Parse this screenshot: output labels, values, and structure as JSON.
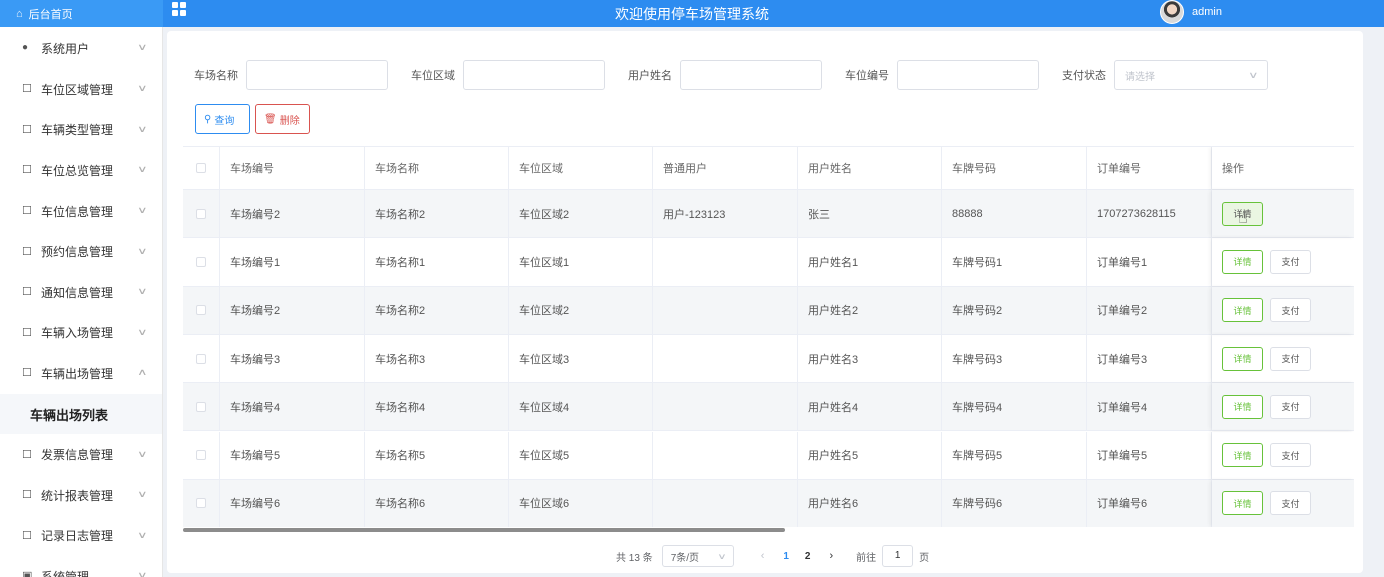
{
  "header": {
    "home_label": "后台首页",
    "title": "欢迎使用停车场管理系统",
    "user_name": "admin"
  },
  "sidebar": {
    "items": [
      {
        "label": "系统用户",
        "icon": "user-icon"
      },
      {
        "label": "车位区域管理",
        "icon": "folder-icon"
      },
      {
        "label": "车辆类型管理",
        "icon": "folder-icon"
      },
      {
        "label": "车位总览管理",
        "icon": "folder-icon"
      },
      {
        "label": "车位信息管理",
        "icon": "folder-icon"
      },
      {
        "label": "预约信息管理",
        "icon": "folder-icon"
      },
      {
        "label": "通知信息管理",
        "icon": "folder-icon"
      },
      {
        "label": "车辆入场管理",
        "icon": "folder-icon"
      },
      {
        "label": "车辆出场管理",
        "icon": "folder-icon"
      },
      {
        "label": "车辆出场列表",
        "icon": ""
      },
      {
        "label": "发票信息管理",
        "icon": "folder-icon"
      },
      {
        "label": "统计报表管理",
        "icon": "folder-icon"
      },
      {
        "label": "记录日志管理",
        "icon": "folder-icon"
      },
      {
        "label": "系统管理",
        "icon": "settings-icon"
      }
    ]
  },
  "search": {
    "fields": [
      {
        "label": "车场名称",
        "value": ""
      },
      {
        "label": "车位区域",
        "value": ""
      },
      {
        "label": "用户姓名",
        "value": ""
      },
      {
        "label": "车位编号",
        "value": ""
      }
    ],
    "pay_status_label": "支付状态",
    "pay_status_placeholder": "请选择",
    "query_label": "查询",
    "delete_label": "删除"
  },
  "table": {
    "columns": [
      "车场编号",
      "车场名称",
      "车位区域",
      "普通用户",
      "用户姓名",
      "车牌号码",
      "订单编号",
      "操作"
    ],
    "rows": [
      [
        "车场编号2",
        "车场名称2",
        "车位区域2",
        "用户-123123",
        "张三",
        "88888",
        "1707273628115"
      ],
      [
        "车场编号1",
        "车场名称1",
        "车位区域1",
        "",
        "用户姓名1",
        "车牌号码1",
        "订单编号1"
      ],
      [
        "车场编号2",
        "车场名称2",
        "车位区域2",
        "",
        "用户姓名2",
        "车牌号码2",
        "订单编号2"
      ],
      [
        "车场编号3",
        "车场名称3",
        "车位区域3",
        "",
        "用户姓名3",
        "车牌号码3",
        "订单编号3"
      ],
      [
        "车场编号4",
        "车场名称4",
        "车位区域4",
        "",
        "用户姓名4",
        "车牌号码4",
        "订单编号4"
      ],
      [
        "车场编号5",
        "车场名称5",
        "车位区域5",
        "",
        "用户姓名5",
        "车牌号码5",
        "订单编号5"
      ],
      [
        "车场编号6",
        "车场名称6",
        "车位区域6",
        "",
        "用户姓名6",
        "车牌号码6",
        "订单编号6"
      ]
    ],
    "detail_label": "详情",
    "pay_label": "支付"
  },
  "pagination": {
    "total_text": "共 13 条",
    "page_size_text": "7条/页",
    "pages": [
      "1",
      "2"
    ],
    "current_page": "1",
    "goto_label": "前往",
    "goto_value": "1",
    "page_unit": "页"
  }
}
